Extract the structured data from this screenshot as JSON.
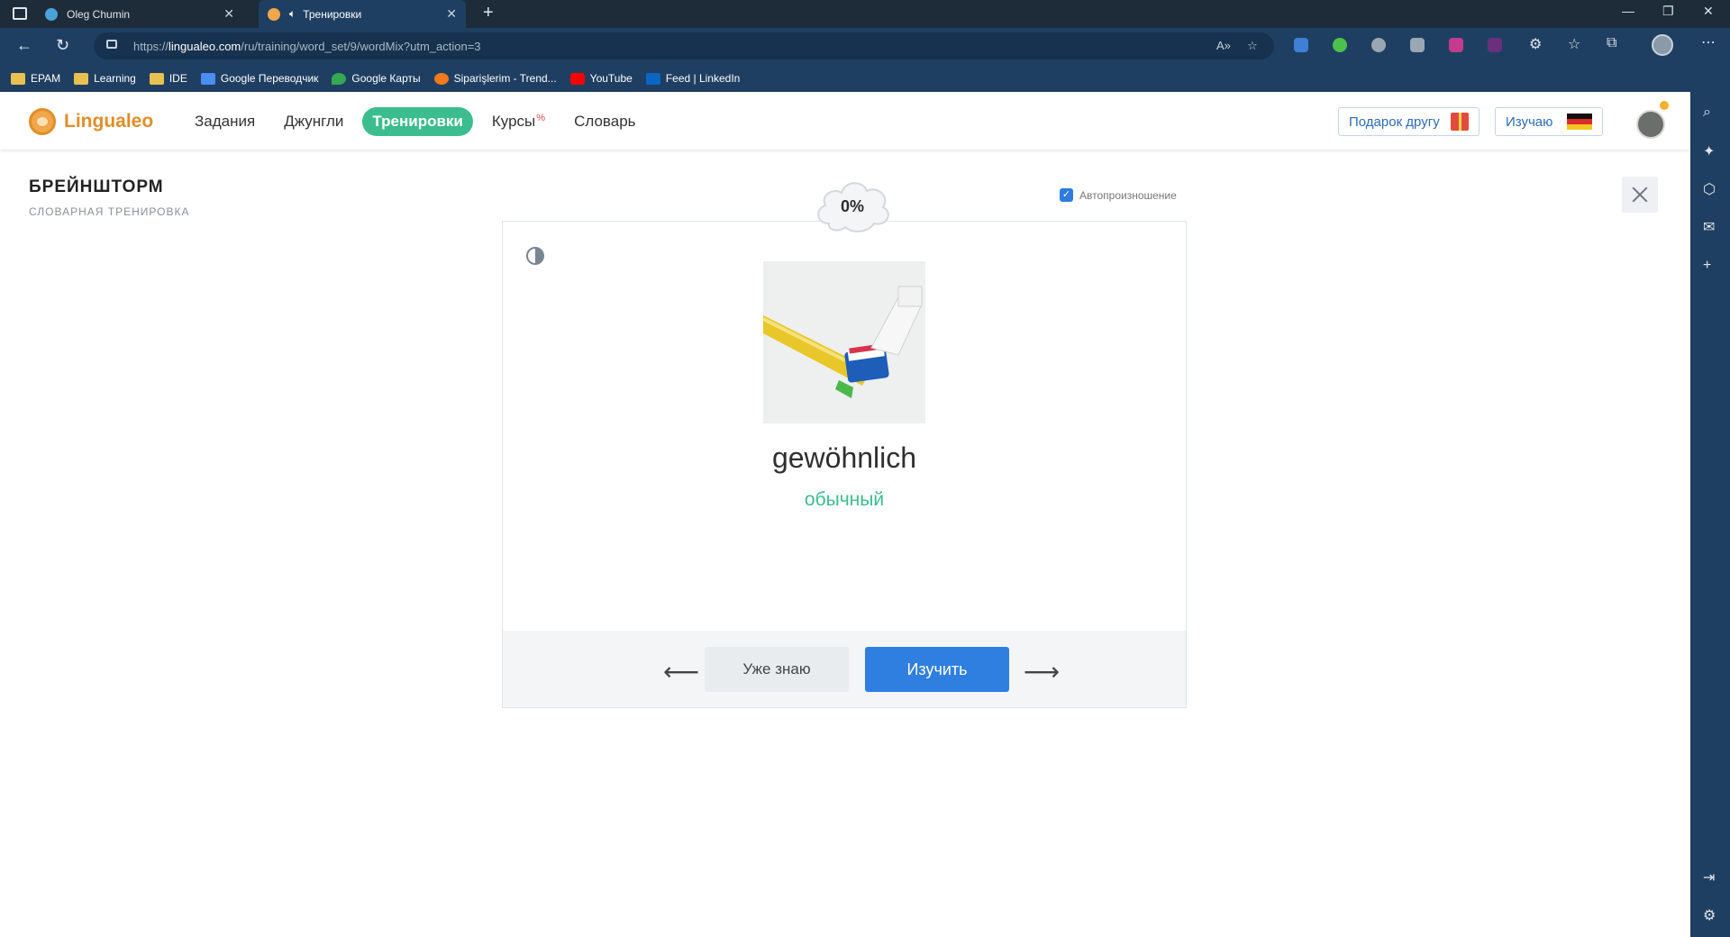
{
  "browser": {
    "tabs": [
      {
        "title": "Oleg Chumin",
        "active": false
      },
      {
        "title": "Тренировки",
        "active": true
      }
    ],
    "url_prefix": "https://",
    "url_host": "lingualeo.com",
    "url_path": "/ru/training/word_set/9/wordMix?utm_action=3",
    "bookmarks": [
      {
        "label": "EPAM",
        "icon": "folder-icon"
      },
      {
        "label": "Learning",
        "icon": "folder-icon"
      },
      {
        "label": "IDE",
        "icon": "folder-icon"
      },
      {
        "label": "Google Переводчик",
        "icon": "google-translate-icon"
      },
      {
        "label": "Google Карты",
        "icon": "google-maps-icon"
      },
      {
        "label": "Siparişlerim - Trend...",
        "icon": "trendyol-icon"
      },
      {
        "label": "YouTube",
        "icon": "youtube-icon"
      },
      {
        "label": "Feed | LinkedIn",
        "icon": "linkedin-icon"
      }
    ]
  },
  "site": {
    "logo": "Lingualeo",
    "nav": [
      {
        "label": "Задания",
        "active": false
      },
      {
        "label": "Джунгли",
        "active": false
      },
      {
        "label": "Тренировки",
        "active": true
      },
      {
        "label": "Курсы",
        "active": false,
        "badge": "%"
      },
      {
        "label": "Словарь",
        "active": false
      }
    ],
    "gift_button": "Подарок другу",
    "learning_button": "Изучаю",
    "learning_language": "German"
  },
  "training": {
    "title": "БРЕЙНШТОРМ",
    "subtitle": "СЛОВАРНАЯ ТРЕНИРОВКА",
    "progress": "0%",
    "autopronounce_label": "Автопроизношение",
    "autopronounce_checked": true,
    "word": "gewöhnlich",
    "translation": "обычный",
    "know_button": "Уже знаю",
    "learn_button": "Изучить",
    "prev_arrow": "⟵",
    "next_arrow": "⟶"
  },
  "colors": {
    "accent_green": "#3bbd8e",
    "accent_blue": "#2e7fe0",
    "brand_orange": "#e08e2a",
    "chrome_blue": "#1f3f62"
  }
}
